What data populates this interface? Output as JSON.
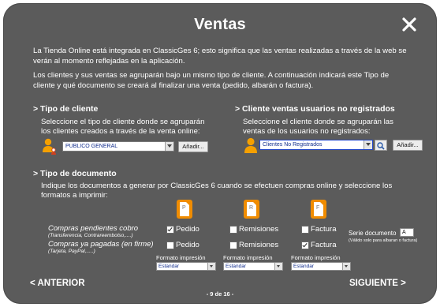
{
  "dialog": {
    "title": "Ventas",
    "close_icon": "close-icon"
  },
  "intro": {
    "paragraph1": "La Tienda Online está integrada en ClassicGes 6; esto significa que las ventas realizadas a través de la web se verán al momento reflejadas en la aplicación.",
    "paragraph2": "Los clientes y sus ventas se agruparán bajo un mismo tipo de cliente. A continuación indicará este Tipo de cliente y qué documento se creará al finalizar una venta (pedido, albarán o factura)."
  },
  "client_type": {
    "heading": "> Tipo de cliente",
    "description": "Seleccione el tipo de cliente donde se agruparán los clientes creados a través de la venta online:",
    "selected": "PUBLICO GENERAL",
    "add_label": "Añadir..."
  },
  "unregistered": {
    "heading": "> Cliente ventas usuarios no registrados",
    "description": "Seleccione el cliente donde se agruparán las ventas de los usuarios no registrados:",
    "selected": "Clientes No Registrados",
    "add_label": "Añadir..."
  },
  "document_type": {
    "heading": "> Tipo de documento",
    "description": "Indique los documentos a generar por ClassicGes 6 cuando se efectuen compras online y seleccione los formatos a imprimir:",
    "doc_icons": [
      "P",
      "R",
      "F"
    ],
    "rows": [
      {
        "label": "Compras pendientes cobro",
        "sub": "(Transferencia, Contrareembolso,....)",
        "options": [
          {
            "label": "Pedido",
            "checked": true
          },
          {
            "label": "Remisiones",
            "checked": false
          },
          {
            "label": "Factura",
            "checked": false
          }
        ]
      },
      {
        "label": "Compras ya pagadas (en firme)",
        "sub": "(Tarjeta, PayPal,.....)",
        "options": [
          {
            "label": "Pedido",
            "checked": false
          },
          {
            "label": "Remisiones",
            "checked": false
          },
          {
            "label": "Factura",
            "checked": true
          }
        ]
      }
    ],
    "format_label": "Formato impresión",
    "format_values": [
      "Estandar",
      "Estandar",
      "Estandar"
    ],
    "serie_label": "Serie documento",
    "serie_value": "A",
    "serie_note": "(Válido solo para albaran o factura)"
  },
  "navigation": {
    "prev": "< ANTERIOR",
    "next": "SIGUIENTE >",
    "page": "- 9 de 16 -"
  },
  "colors": {
    "background": "#5b5b5b",
    "accent_orange": "#f08c00",
    "text": "#ffffff"
  }
}
